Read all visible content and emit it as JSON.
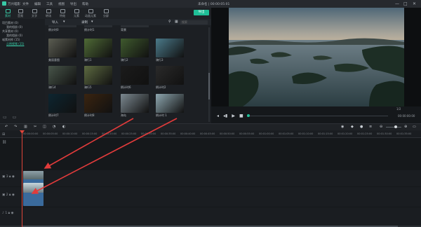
{
  "titlebar": {
    "app": "万兴喵影",
    "menu": [
      "文件",
      "编辑",
      "工具",
      "视图",
      "导出",
      "帮助"
    ],
    "title": "未命名 | 00:00:05:01",
    "win_controls": [
      "—",
      "□",
      "✕"
    ]
  },
  "toolbar": {
    "tabs": [
      "素材",
      "音频",
      "文字",
      "转场",
      "特效",
      "元素",
      "动画元素",
      "分屏"
    ],
    "export": "导出"
  },
  "sidebar": {
    "items": [
      {
        "label": "项目素材 (0)",
        "indent": false
      },
      {
        "label": "我的相册 (0)",
        "indent": true
      },
      {
        "label": "共享素材 (0)",
        "indent": false
      },
      {
        "label": "我的相册 (0)",
        "indent": true
      },
      {
        "label": "喵素材库 (15)",
        "indent": false
      },
      {
        "label": "示例视频 (15)",
        "indent": true,
        "link": true
      }
    ],
    "bottom_icons": [
      "folder-add-icon",
      "folder-icon"
    ]
  },
  "media": {
    "import": "导入",
    "record": "录制",
    "search_placeholder": "搜索",
    "top_labels": [
      "倒计时0",
      "倒计时1",
      "背景"
    ],
    "rows": [
      [
        {
          "label": "美丽意图",
          "color": "#5b5d52"
        },
        {
          "label": "骑行1",
          "color": "#4f6a36"
        },
        {
          "label": "骑行2",
          "color": "#3f5a2e"
        },
        {
          "label": "骑行3",
          "color": "#4b7a8a"
        }
      ],
      [
        {
          "label": "骑行4",
          "color": "#48554a"
        },
        {
          "label": "骑行5",
          "color": "#5d6a41"
        },
        {
          "label": "倒计时6",
          "color": "#1b1b1b"
        },
        {
          "label": "倒计时2",
          "color": "#2a2a2a"
        }
      ],
      [
        {
          "label": "倒计时7",
          "color": "#0d2530"
        },
        {
          "label": "倒计时8",
          "color": "#3a2410"
        },
        {
          "label": "海岛",
          "color": "#7c8991"
        },
        {
          "label": "倒计时 1",
          "color": "#8ea7b0"
        }
      ]
    ]
  },
  "preview": {
    "timecode": "00:00:00:00",
    "zoom": "1/2"
  },
  "timeline": {
    "ruler": [
      "00:00:00:00",
      "00:00:05:00",
      "00:00:10:00",
      "00:00:15:00",
      "00:00:20:00",
      "00:00:25:00",
      "00:00:30:00",
      "00:00:35:00",
      "00:00:40:00",
      "00:00:45:00",
      "00:00:50:00",
      "00:00:55:00",
      "00:01:00:00",
      "00:01:05:00",
      "00:01:10:00",
      "00:01:15:00",
      "00:01:20:00",
      "00:01:25:00",
      "00:01:30:00",
      "00:01:35:00"
    ],
    "tracks": [
      "3",
      "2",
      "1"
    ]
  },
  "colors": {
    "accent": "#1fbf97",
    "playhead": "#e0453a",
    "arrow": "#e23b3b"
  }
}
